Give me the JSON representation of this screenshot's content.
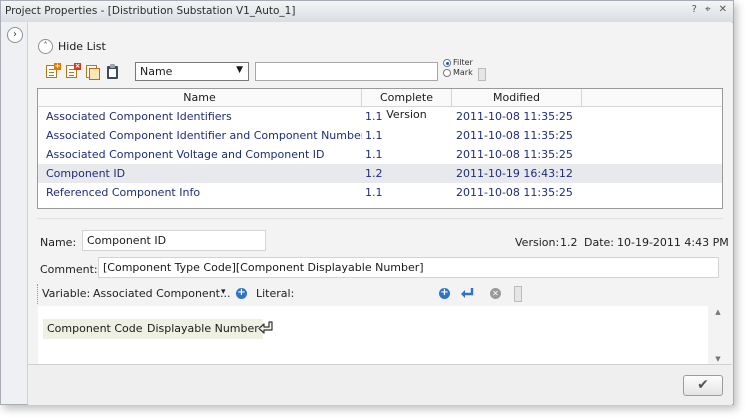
{
  "window": {
    "title": "Project Properties - [Distribution Substation V1_Auto_1]",
    "controls": [
      "?",
      "⌖",
      "✕"
    ]
  },
  "sidebar": {
    "expand_glyph": "›"
  },
  "list_toggle": {
    "glyph": "˄",
    "label": "Hide List"
  },
  "toolbar": {
    "icons": [
      "new-document-icon",
      "delete-document-icon",
      "copy-document-icon",
      "paste-clipboard-icon"
    ],
    "field_select": "Name",
    "filter_value": "",
    "radio_filter": "Filter",
    "radio_mark": "Mark",
    "selected_radio": "Filter"
  },
  "grid": {
    "headers": [
      "Name",
      "Complete Version",
      "Modified",
      ""
    ],
    "rows": [
      {
        "name": "Associated Component Identifiers",
        "version": "1.1",
        "modified": "2011-10-08 11:35:25"
      },
      {
        "name": "Associated Component Identifier and Component Number",
        "version": "1.1",
        "modified": "2011-10-08 11:35:25"
      },
      {
        "name": "Associated Component Voltage and Component ID",
        "version": "1.1",
        "modified": "2011-10-08 11:35:25"
      },
      {
        "name": "Component ID",
        "version": "1.2",
        "modified": "2011-10-19 16:43:12"
      },
      {
        "name": "Referenced Component Info",
        "version": "1.1",
        "modified": "2011-10-08 11:35:25"
      }
    ],
    "selected_index": 3
  },
  "detail": {
    "name_label": "Name:",
    "name_value": "Component ID",
    "version_label": "Version:",
    "version_value": "1.2",
    "date_label": "Date:",
    "date_value": "10-19-2011 4:43 PM",
    "comment_label": "Comment:",
    "comment_value": "[Component Type Code][Component Displayable Number]",
    "variable_label": "Variable:",
    "variable_value": "Associated Component...",
    "variable_caret": "▾",
    "literal_label": "Literal:",
    "literal_value": "",
    "plus_glyph": "+",
    "clear_glyph": "✕",
    "enter_glyph": "↵",
    "chips": [
      "Component Code",
      "Displayable Number"
    ],
    "scroll_up": "▲",
    "scroll_down": "▼"
  },
  "footer": {
    "ok_glyph": "✔"
  },
  "colors": {
    "link_text": "#1f2c7a",
    "selected_row": "#e8e9ec",
    "accent_blue": "#2f72c7"
  }
}
